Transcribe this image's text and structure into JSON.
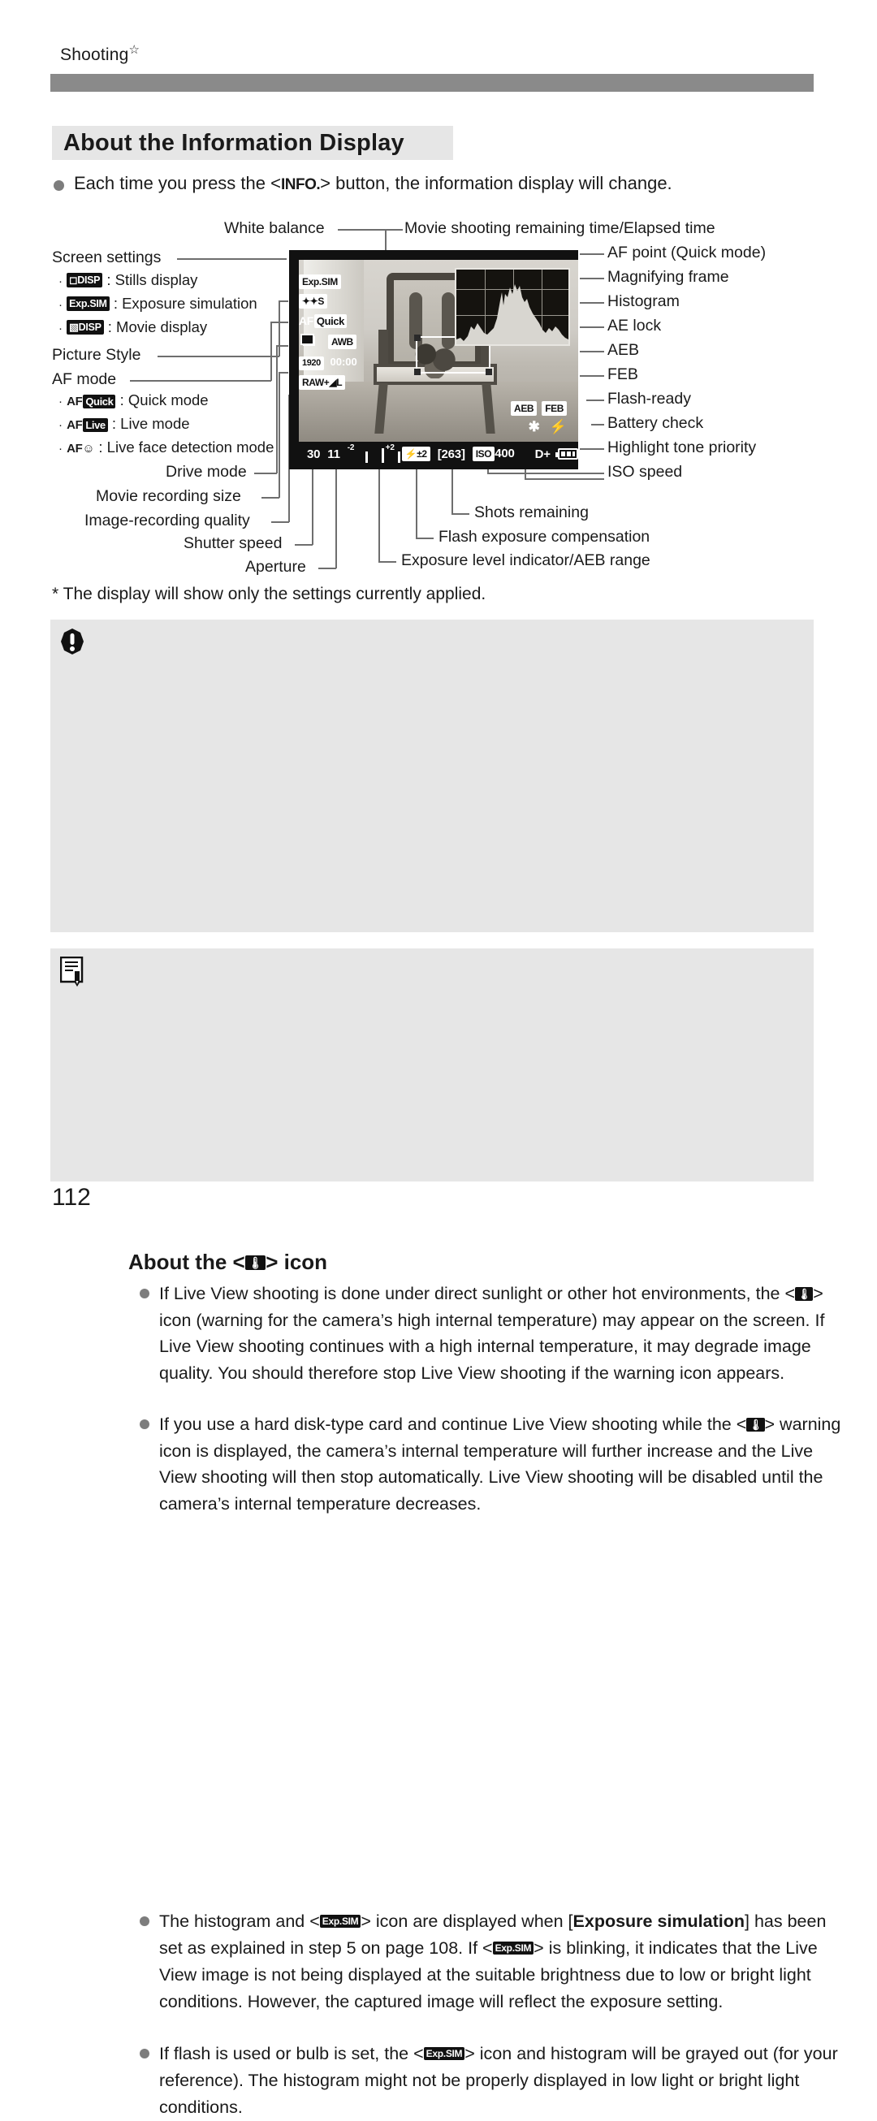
{
  "running_head": {
    "text": "Shooting",
    "star": "☆"
  },
  "section": {
    "title": "About the Information Display"
  },
  "intro": {
    "before": "Each time you press the <",
    "icon": "INFO.",
    "after": "> button, the information display will change."
  },
  "diagram": {
    "labels_top": [
      {
        "key": "white_balance",
        "text": "White balance"
      },
      {
        "key": "movie_time",
        "text": "Movie shooting remaining time/Elapsed time"
      }
    ],
    "labels_left": [
      {
        "key": "screen_settings",
        "text": "Screen settings"
      },
      {
        "key": "picture_style",
        "text": "Picture Style"
      },
      {
        "key": "af_mode",
        "text": "AF mode"
      },
      {
        "key": "drive_mode",
        "text": "Drive mode"
      },
      {
        "key": "movie_rec_size",
        "text": "Movie recording size"
      },
      {
        "key": "image_quality",
        "text": "Image-recording quality"
      },
      {
        "key": "shutter_speed",
        "text": "Shutter speed"
      },
      {
        "key": "aperture",
        "text": "Aperture"
      }
    ],
    "screen_settings_items": [
      {
        "icon": "DISP",
        "icon_prefix": "camera",
        "text": ": Stills display"
      },
      {
        "icon": "Exp.SIM",
        "icon_prefix": "",
        "text": ": Exposure simulation"
      },
      {
        "icon": "DISP",
        "icon_prefix": "movie",
        "text": ": Movie display"
      }
    ],
    "af_mode_items": [
      {
        "icon": "Quick",
        "text": ": Quick mode"
      },
      {
        "icon": "Live",
        "text": ": Live mode"
      },
      {
        "icon": "face",
        "text": ": Live face detection mode"
      }
    ],
    "labels_right": [
      {
        "key": "af_point",
        "text": "AF point (Quick mode)"
      },
      {
        "key": "magnifying_frame",
        "text": "Magnifying frame"
      },
      {
        "key": "histogram",
        "text": "Histogram"
      },
      {
        "key": "ae_lock",
        "text": "AE lock"
      },
      {
        "key": "aeb",
        "text": "AEB"
      },
      {
        "key": "feb",
        "text": "FEB"
      },
      {
        "key": "flash_ready",
        "text": "Flash-ready"
      },
      {
        "key": "battery_check",
        "text": "Battery check"
      },
      {
        "key": "highlight_tone",
        "text": "Highlight tone priority"
      },
      {
        "key": "iso_speed",
        "text": "ISO speed"
      }
    ],
    "labels_bottom": [
      {
        "key": "shots_remaining",
        "text": "Shots remaining"
      },
      {
        "key": "flash_exp_comp",
        "text": "Flash exposure compensation"
      },
      {
        "key": "exposure_level",
        "text": "Exposure level indicator/AEB range"
      }
    ]
  },
  "lcd": {
    "exp_sim": "Exp.SIM",
    "picture_style": "S",
    "af_mode": "Quick",
    "af_prefix": "AF",
    "white_balance": "AWB",
    "movie_size": "1920",
    "movie_time": "00:00",
    "quality": "RAW+",
    "quality_size": "L",
    "shutter_speed": "30",
    "aperture": "11",
    "exp_scale_left": "-2",
    "exp_scale_mid": "1",
    "exp_scale_right": "+2",
    "flash_comp": "±2",
    "shots_remaining": "[263]",
    "iso_label": "ISO",
    "iso_value": "400",
    "highlight_tone": "D+",
    "aeb": "AEB",
    "feb": "FEB",
    "ae_lock": "✱",
    "flash_ready": "⚡"
  },
  "footnote": {
    "text": "* The display will show only the settings currently applied."
  },
  "caution": {
    "title_before": "About the <",
    "title_icon": "temperature-warning",
    "title_after": "> icon",
    "items": [
      "If Live View shooting is done under direct sunlight or other hot environments, the < ■ > icon (warning for the camera’s high internal temperature) may appear on the screen. If Live View shooting continues with a high internal temperature, it may degrade image quality. You should therefore stop Live View shooting if the warning icon appears.",
      "If you use a hard disk-type card and continue Live View shooting while the < ■ > warning icon is displayed, the camera’s internal temperature will further increase and the Live View shooting will then stop automatically. Live View shooting will be disabled until the camera’s internal temperature decreases."
    ],
    "item1_parts": {
      "p1": "If Live View shooting is done under direct sunlight or other hot environments, the <",
      "p2": "> icon (warning for the camera’s high internal temperature) may appear on the screen. If Live View shooting continues with a high internal temperature, it may degrade image quality. You should therefore stop Live View shooting if the warning icon appears."
    },
    "item2_parts": {
      "p1": "If you use a hard disk-type card and continue Live View shooting while the <",
      "p2": "> warning icon is displayed, the camera’s internal temperature will further increase and the Live View shooting will then stop automatically. Live View shooting will be disabled until the camera’s internal temperature decreases."
    }
  },
  "note": {
    "item1_parts": {
      "p1": "The histogram and <",
      "p2": "> icon are displayed when [",
      "bold1": "Exposure simulation",
      "p3": "] has been set as explained in step 5 on page 108. If <",
      "p4": "> is blinking, it indicates that the Live View image is not being displayed at the suitable brightness due to low or bright light conditions. However, the captured image will reflect the exposure setting."
    },
    "item2_parts": {
      "p1": "If flash is used or bulb is set, the <",
      "p2": "> icon and histogram will be grayed out (for your reference). The histogram might not be properly displayed in low light or bright light conditions."
    },
    "icon_label": "Exp.SIM"
  },
  "page_number": "112",
  "colors": {
    "rule": "#8a8a8a",
    "panel": "#e6e6e6",
    "bullet": "#7d7d7d",
    "leader": "#6e6e6e",
    "lcd_bg": "#111111"
  }
}
